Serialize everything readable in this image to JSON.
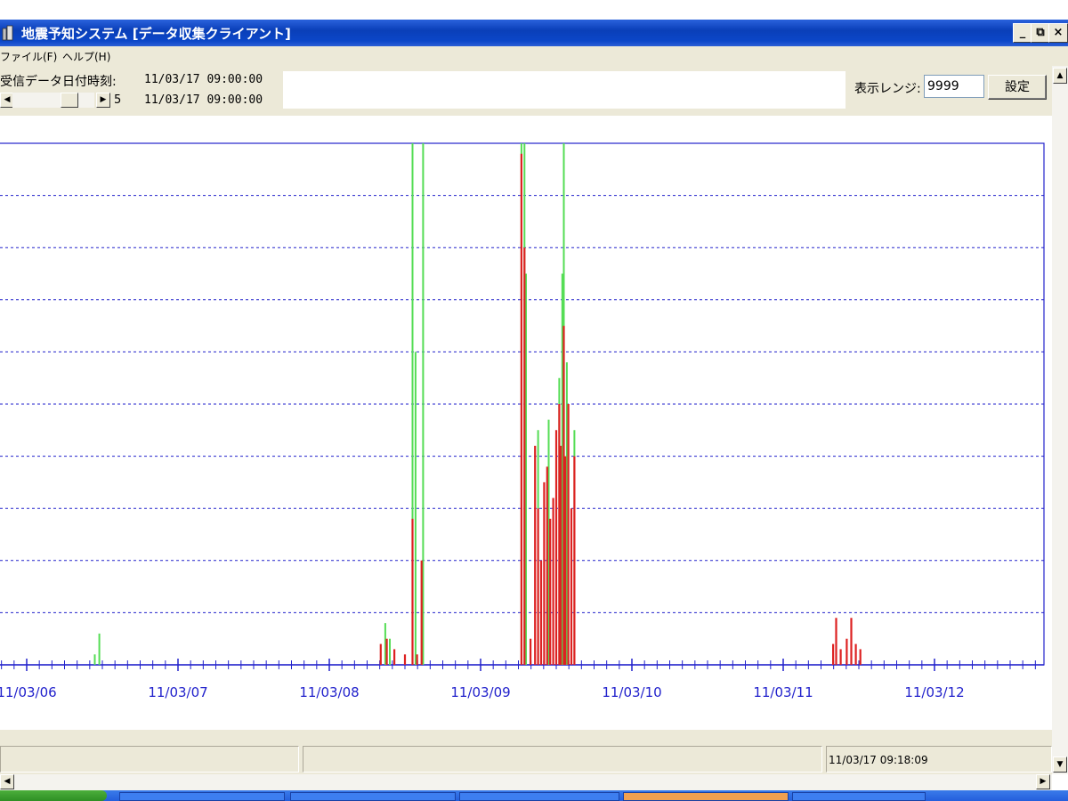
{
  "window": {
    "title": "地震予知システム [データ収集クライアント]",
    "btn_minimize": "_",
    "btn_restore": "⧉",
    "btn_close": "×"
  },
  "menu": [
    {
      "label": "ファイル(F)"
    },
    {
      "label": "ヘルプ(H)"
    }
  ],
  "toolbar": {
    "received_label": "受信データ日付時刻:",
    "received_value": "11/03/17 09:00:00",
    "scroll_value": "5",
    "scroll_time": "11/03/17 09:00:00",
    "range_label": "表示レンジ:",
    "range_value": "9999",
    "set_button": "設定"
  },
  "status": {
    "timestamp": "11/03/17 09:18:09"
  },
  "colors": {
    "series_a": "#55dd55",
    "series_b": "#dd2222",
    "axis": "#2222cc",
    "titlebar": "#0a3fb8"
  },
  "chart_data": {
    "type": "bar",
    "x_tick_labels": [
      "11/03/06",
      "11/03/07",
      "11/03/08",
      "11/03/09",
      "11/03/10",
      "11/03/11",
      "11/03/12"
    ],
    "x_unit": "days since 11/03/06 00:00",
    "gridlines": 10,
    "ylim": [
      0,
      100
    ],
    "series": [
      {
        "name": "",
        "color": "#55dd55",
        "points": [
          [
            0.45,
            2
          ],
          [
            0.48,
            6
          ],
          [
            2.37,
            8
          ],
          [
            2.4,
            5
          ],
          [
            2.55,
            100
          ],
          [
            2.57,
            60
          ],
          [
            2.62,
            100
          ],
          [
            3.27,
            100
          ],
          [
            3.29,
            100
          ],
          [
            3.3,
            75
          ],
          [
            3.38,
            45
          ],
          [
            3.45,
            47
          ],
          [
            3.52,
            55
          ],
          [
            3.54,
            75
          ],
          [
            3.55,
            100
          ],
          [
            3.57,
            58
          ],
          [
            3.62,
            45
          ]
        ]
      },
      {
        "name": "",
        "color": "#dd2222",
        "points": [
          [
            2.34,
            4
          ],
          [
            2.38,
            5
          ],
          [
            2.43,
            3
          ],
          [
            2.5,
            2
          ],
          [
            2.55,
            28
          ],
          [
            2.58,
            2
          ],
          [
            2.61,
            20
          ],
          [
            3.27,
            98
          ],
          [
            3.29,
            80
          ],
          [
            3.33,
            5
          ],
          [
            3.36,
            42
          ],
          [
            3.38,
            30
          ],
          [
            3.4,
            20
          ],
          [
            3.42,
            35
          ],
          [
            3.44,
            38
          ],
          [
            3.46,
            28
          ],
          [
            3.48,
            32
          ],
          [
            3.5,
            45
          ],
          [
            3.52,
            50
          ],
          [
            3.53,
            42
          ],
          [
            3.55,
            65
          ],
          [
            3.56,
            40
          ],
          [
            3.58,
            50
          ],
          [
            3.6,
            30
          ],
          [
            3.62,
            40
          ],
          [
            5.33,
            4
          ],
          [
            5.35,
            9
          ],
          [
            5.38,
            3
          ],
          [
            5.42,
            5
          ],
          [
            5.45,
            9
          ],
          [
            5.48,
            4
          ],
          [
            5.51,
            3
          ]
        ]
      }
    ]
  }
}
